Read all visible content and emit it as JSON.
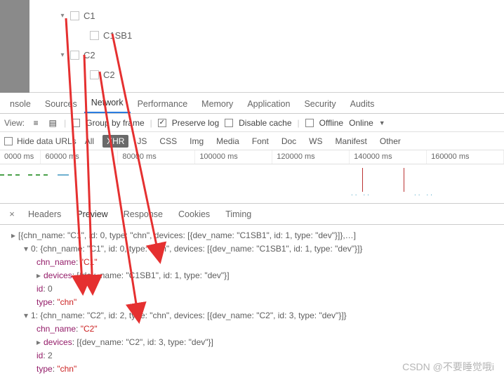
{
  "tree": {
    "items": [
      {
        "label": "C1",
        "indent": 40,
        "expander": "▾"
      },
      {
        "label": "C1SB1",
        "indent": 68,
        "expander": ""
      },
      {
        "label": "C2",
        "indent": 40,
        "expander": "▾"
      },
      {
        "label": "C2",
        "indent": 68,
        "expander": ""
      }
    ]
  },
  "main_tabs": [
    "nsole",
    "Sources",
    "Network",
    "Performance",
    "Memory",
    "Application",
    "Security",
    "Audits"
  ],
  "main_tabs_active": 2,
  "toolbar": {
    "view_label": "View:",
    "group_by_frame": "Group by frame",
    "preserve_log": "Preserve log",
    "disable_cache": "Disable cache",
    "offline": "Offline",
    "online": "Online"
  },
  "filters": {
    "hide_data_urls": "Hide data URLs",
    "items": [
      "All",
      "XHR",
      "JS",
      "CSS",
      "Img",
      "Media",
      "Font",
      "Doc",
      "WS",
      "Manifest",
      "Other"
    ],
    "active": 1
  },
  "timeline": {
    "ticks": [
      "0000 ms",
      "60000 ms",
      "80000 ms",
      "100000 ms",
      "120000 ms",
      "140000 ms",
      "160000 ms"
    ]
  },
  "resp_tabs": [
    "Headers",
    "Preview",
    "Response",
    "Cookies",
    "Timing"
  ],
  "resp_tabs_active": 1,
  "json": {
    "root": "[{chn_name: \"C1\", id: 0, type: \"chn\", devices: [{dev_name: \"C1SB1\", id: 1, type: \"dev\"}]},…]",
    "items": [
      {
        "header": "0: {chn_name: \"C1\", id: 0, type: \"chn\", devices: [{dev_name: \"C1SB1\", id: 1, type: \"dev\"}]}",
        "chn_name": "\"C1\"",
        "devices": "[{dev_name: \"C1SB1\", id: 1, type: \"dev\"}]",
        "id": "0",
        "type": "\"chn\""
      },
      {
        "header": "1: {chn_name: \"C2\", id: 2, type: \"chn\", devices: [{dev_name: \"C2\", id: 3, type: \"dev\"}]}",
        "chn_name": "\"C2\"",
        "devices": "[{dev_name: \"C2\", id: 3, type: \"dev\"}]",
        "id": "2",
        "type": "\"chn\""
      }
    ]
  },
  "watermark": "CSDN @不要睡觉哦i"
}
